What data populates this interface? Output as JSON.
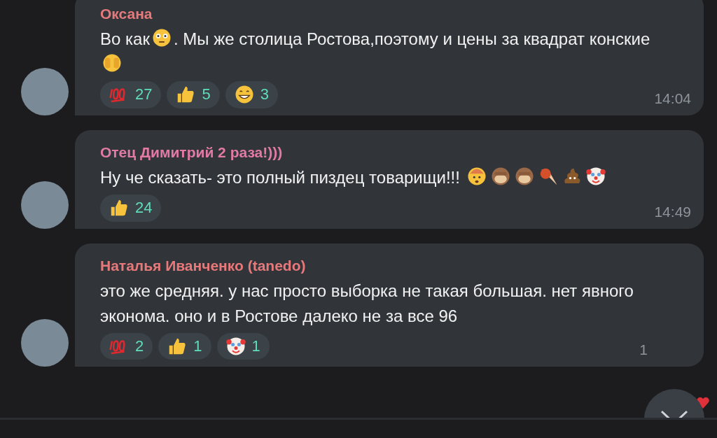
{
  "messages": [
    {
      "author": "Оксана",
      "color": "#e8797a",
      "parts": [
        {
          "kind": "text",
          "text": "Во как"
        },
        {
          "kind": "flushed"
        },
        {
          "kind": "text",
          "text": ". Мы же столица Ростова,поэтому и цены за квадрат конские "
        },
        {
          "kind": "peek"
        }
      ],
      "reactions": [
        {
          "kind": "hundred",
          "count": "27"
        },
        {
          "kind": "thumbs",
          "count": "5"
        },
        {
          "kind": "grin",
          "count": "3"
        }
      ],
      "time": "14:04"
    },
    {
      "author": "Отец Димитрий 2 раза!)))",
      "color": "#e27aa6",
      "parts": [
        {
          "kind": "text",
          "text": "Ну че сказать- это полный пиздец товарищи!!! "
        },
        {
          "kind": "exploding"
        },
        {
          "kind": "monkey"
        },
        {
          "kind": "monkey"
        },
        {
          "kind": "ball"
        },
        {
          "kind": "poop"
        },
        {
          "kind": "clown"
        }
      ],
      "reactions": [
        {
          "kind": "thumbs",
          "count": "24"
        }
      ],
      "time": "14:49"
    },
    {
      "author": "Наталья Иванченко (tanedo)",
      "color": "#e8797a",
      "parts": [
        {
          "kind": "text",
          "text": "это же средняя. у нас просто выборка не такая большая. нет явного эконома. оно и в Ростове далеко не за все 96"
        }
      ],
      "reactions": [
        {
          "kind": "hundred",
          "count": "2"
        },
        {
          "kind": "thumbs",
          "count": "1"
        },
        {
          "kind": "clown",
          "count": "1"
        }
      ],
      "time": "1"
    }
  ]
}
